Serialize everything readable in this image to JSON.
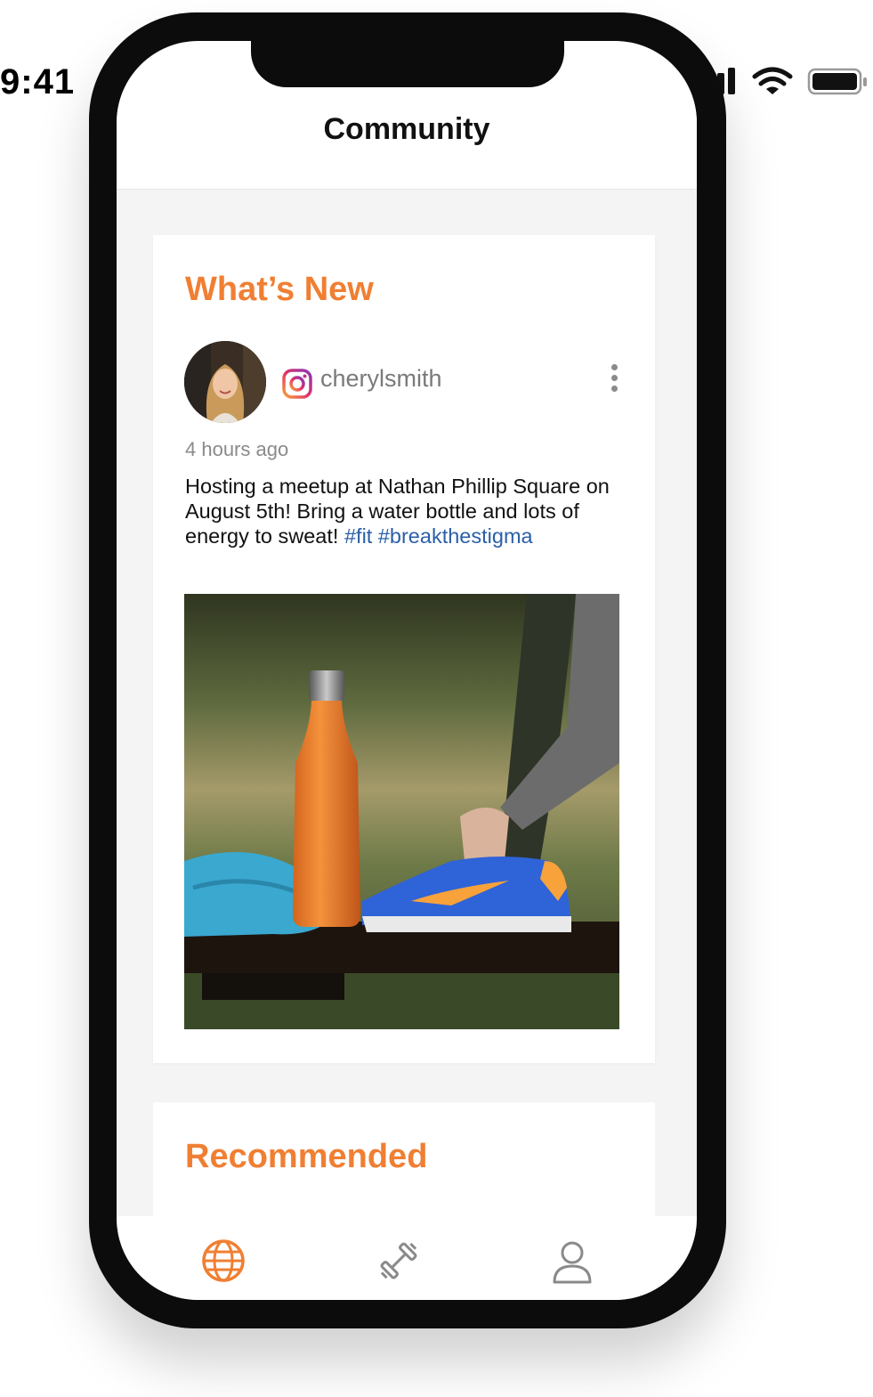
{
  "status_bar": {
    "time": "9:41",
    "icons": [
      "cellular-signal-icon",
      "wifi-icon",
      "battery-icon"
    ]
  },
  "header": {
    "title": "Community"
  },
  "whats_new": {
    "section_title": "What’s New",
    "post": {
      "source_icon": "instagram-icon",
      "username": "cherylsmith",
      "timestamp": "4 hours ago",
      "text": "Hosting a meetup at Nathan Phillip Square on August 5th! Bring a water bottle and lots of energy to sweat! ",
      "hashtags": "#fit #breakthestigma",
      "image_description_icon": "post-photo"
    }
  },
  "recommended": {
    "section_title": "Recommended"
  },
  "tab_bar": {
    "items": [
      {
        "icon": "globe-icon",
        "active": true
      },
      {
        "icon": "dumbbell-icon",
        "active": false
      },
      {
        "icon": "person-icon",
        "active": false
      }
    ]
  },
  "colors": {
    "accent": "#f07f33",
    "hashtag": "#2a5fa8",
    "inactive_icon": "#8a8a8a"
  }
}
